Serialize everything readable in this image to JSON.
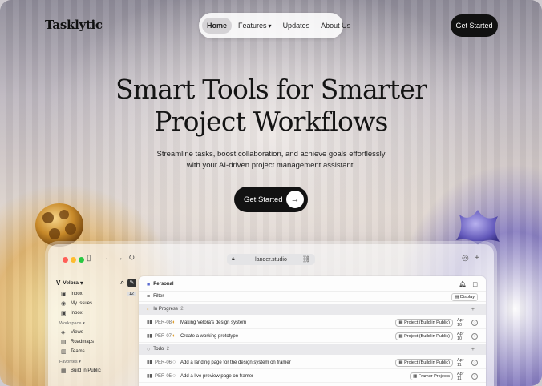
{
  "brand": {
    "logo": "Tasklytic"
  },
  "nav": {
    "items": [
      {
        "label": "Home",
        "active": true
      },
      {
        "label": "Features",
        "dropdown": true
      },
      {
        "label": "Updates"
      },
      {
        "label": "About Us"
      }
    ],
    "cta": "Get Started"
  },
  "hero": {
    "title_line1": "Smart Tools for Smarter",
    "title_line2": "Project Workflows",
    "subtitle_line1": "Streamline tasks, boost collaboration, and achieve goals effortlessly",
    "subtitle_line2": "with your AI-driven project management assistant.",
    "cta": "Get Started",
    "cta_icon": "arrow-right-icon"
  },
  "app": {
    "url": "lander.studio",
    "workspace_name": "Velora",
    "sidebar": {
      "top_items": [
        {
          "label": "Inbox",
          "icon": "inbox-icon",
          "count": "12"
        },
        {
          "label": "My Issues",
          "icon": "issues-icon"
        },
        {
          "label": "Inbox",
          "icon": "inbox-icon"
        }
      ],
      "workspace_label": "Workspace",
      "workspace_items": [
        {
          "label": "Views",
          "icon": "views-icon"
        },
        {
          "label": "Roadmaps",
          "icon": "roadmap-icon"
        },
        {
          "label": "Teams",
          "icon": "teams-icon"
        }
      ],
      "favorites_label": "Favorites",
      "favorite_items": [
        {
          "label": "Build in Public",
          "icon": "grid-icon"
        }
      ]
    },
    "main": {
      "title": "Personal",
      "filter": "Filter",
      "display": "Display",
      "groups": [
        {
          "name": "In Progress",
          "count": "2",
          "tasks": [
            {
              "id": "PER-08",
              "name": "Making Velora's design system",
              "tag": "Project (Build in Public)",
              "date": "Apr 10"
            },
            {
              "id": "PER-07",
              "name": "Create a working prototype",
              "tag": "Project (Build in Public)",
              "date": "Apr 10"
            }
          ]
        },
        {
          "name": "Todo",
          "count": "2",
          "tasks": [
            {
              "id": "PER-06",
              "name": "Add a landing page for the design system on framer",
              "tag": "Project (Build in Public)",
              "date": "Apr 11"
            },
            {
              "id": "PER-05",
              "name": "Add a live preview page on framer",
              "tag": "Framer Projects",
              "date": "Apr 11"
            }
          ]
        }
      ]
    }
  },
  "colors": {
    "dark": "#111111",
    "accent_gold": "#e0a030",
    "accent_violet": "#6a62c0"
  }
}
